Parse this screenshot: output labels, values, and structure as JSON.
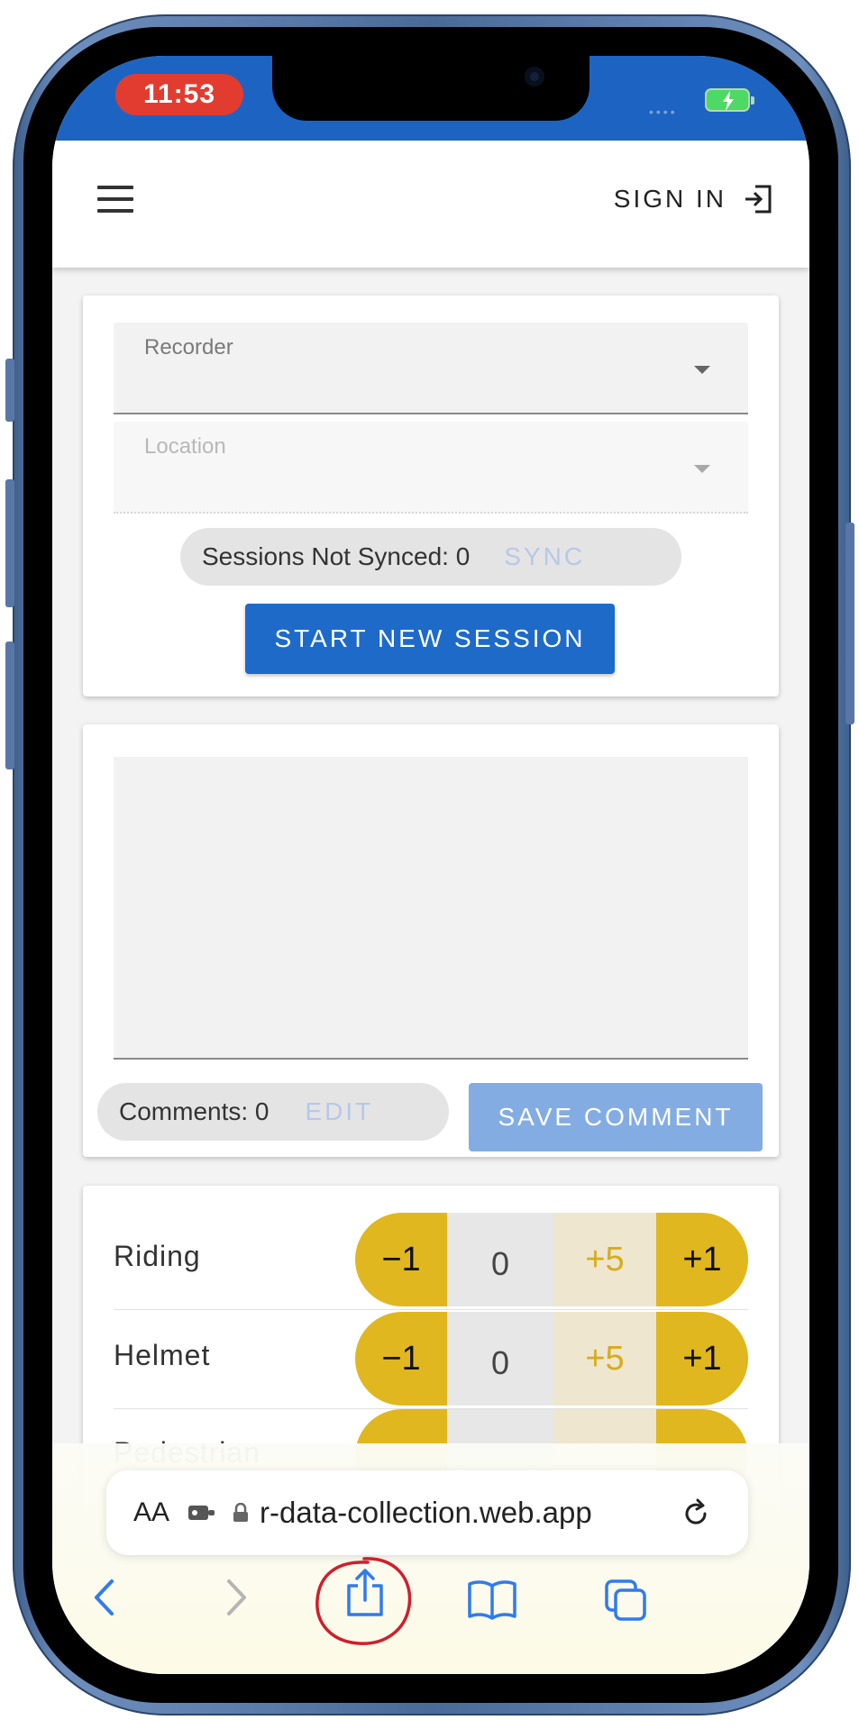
{
  "status_bar": {
    "time": "11:53",
    "accent_color": "#1d64c2",
    "time_pill_color": "#e23c30",
    "battery_icon": "charging-battery-icon"
  },
  "header": {
    "menu_icon": "hamburger-menu-icon",
    "sign_in_label": "SIGN IN",
    "sign_in_icon": "sign-in-icon"
  },
  "session_card": {
    "recorder_label": "Recorder",
    "location_label": "Location",
    "sessions_not_synced": "Sessions Not Synced: 0",
    "sync_label": "SYNC",
    "start_session_label": "START NEW SESSION",
    "button_color": "#1d6ac9"
  },
  "comment_card": {
    "comment_value": "",
    "comments_count": "Comments: 0",
    "edit_label": "EDIT",
    "save_comment_label": "SAVE COMMENT",
    "save_button_color": "#83ace2"
  },
  "counters": {
    "control_color": "#e0b71f",
    "rows": [
      {
        "label": "Riding",
        "minus": "−1",
        "value": "0",
        "plus5": "+5",
        "plus1": "+1"
      },
      {
        "label": "Helmet",
        "minus": "−1",
        "value": "0",
        "plus5": "+5",
        "plus1": "+1"
      }
    ],
    "partial_row_label": "Pedestrian"
  },
  "browser": {
    "aa_label": "AA",
    "url": "r-data-collection.web.app",
    "icons": [
      "back-icon",
      "forward-icon",
      "share-icon",
      "bookmarks-icon",
      "tabs-icon",
      "reload-icon",
      "lock-icon",
      "extension-icon"
    ]
  }
}
